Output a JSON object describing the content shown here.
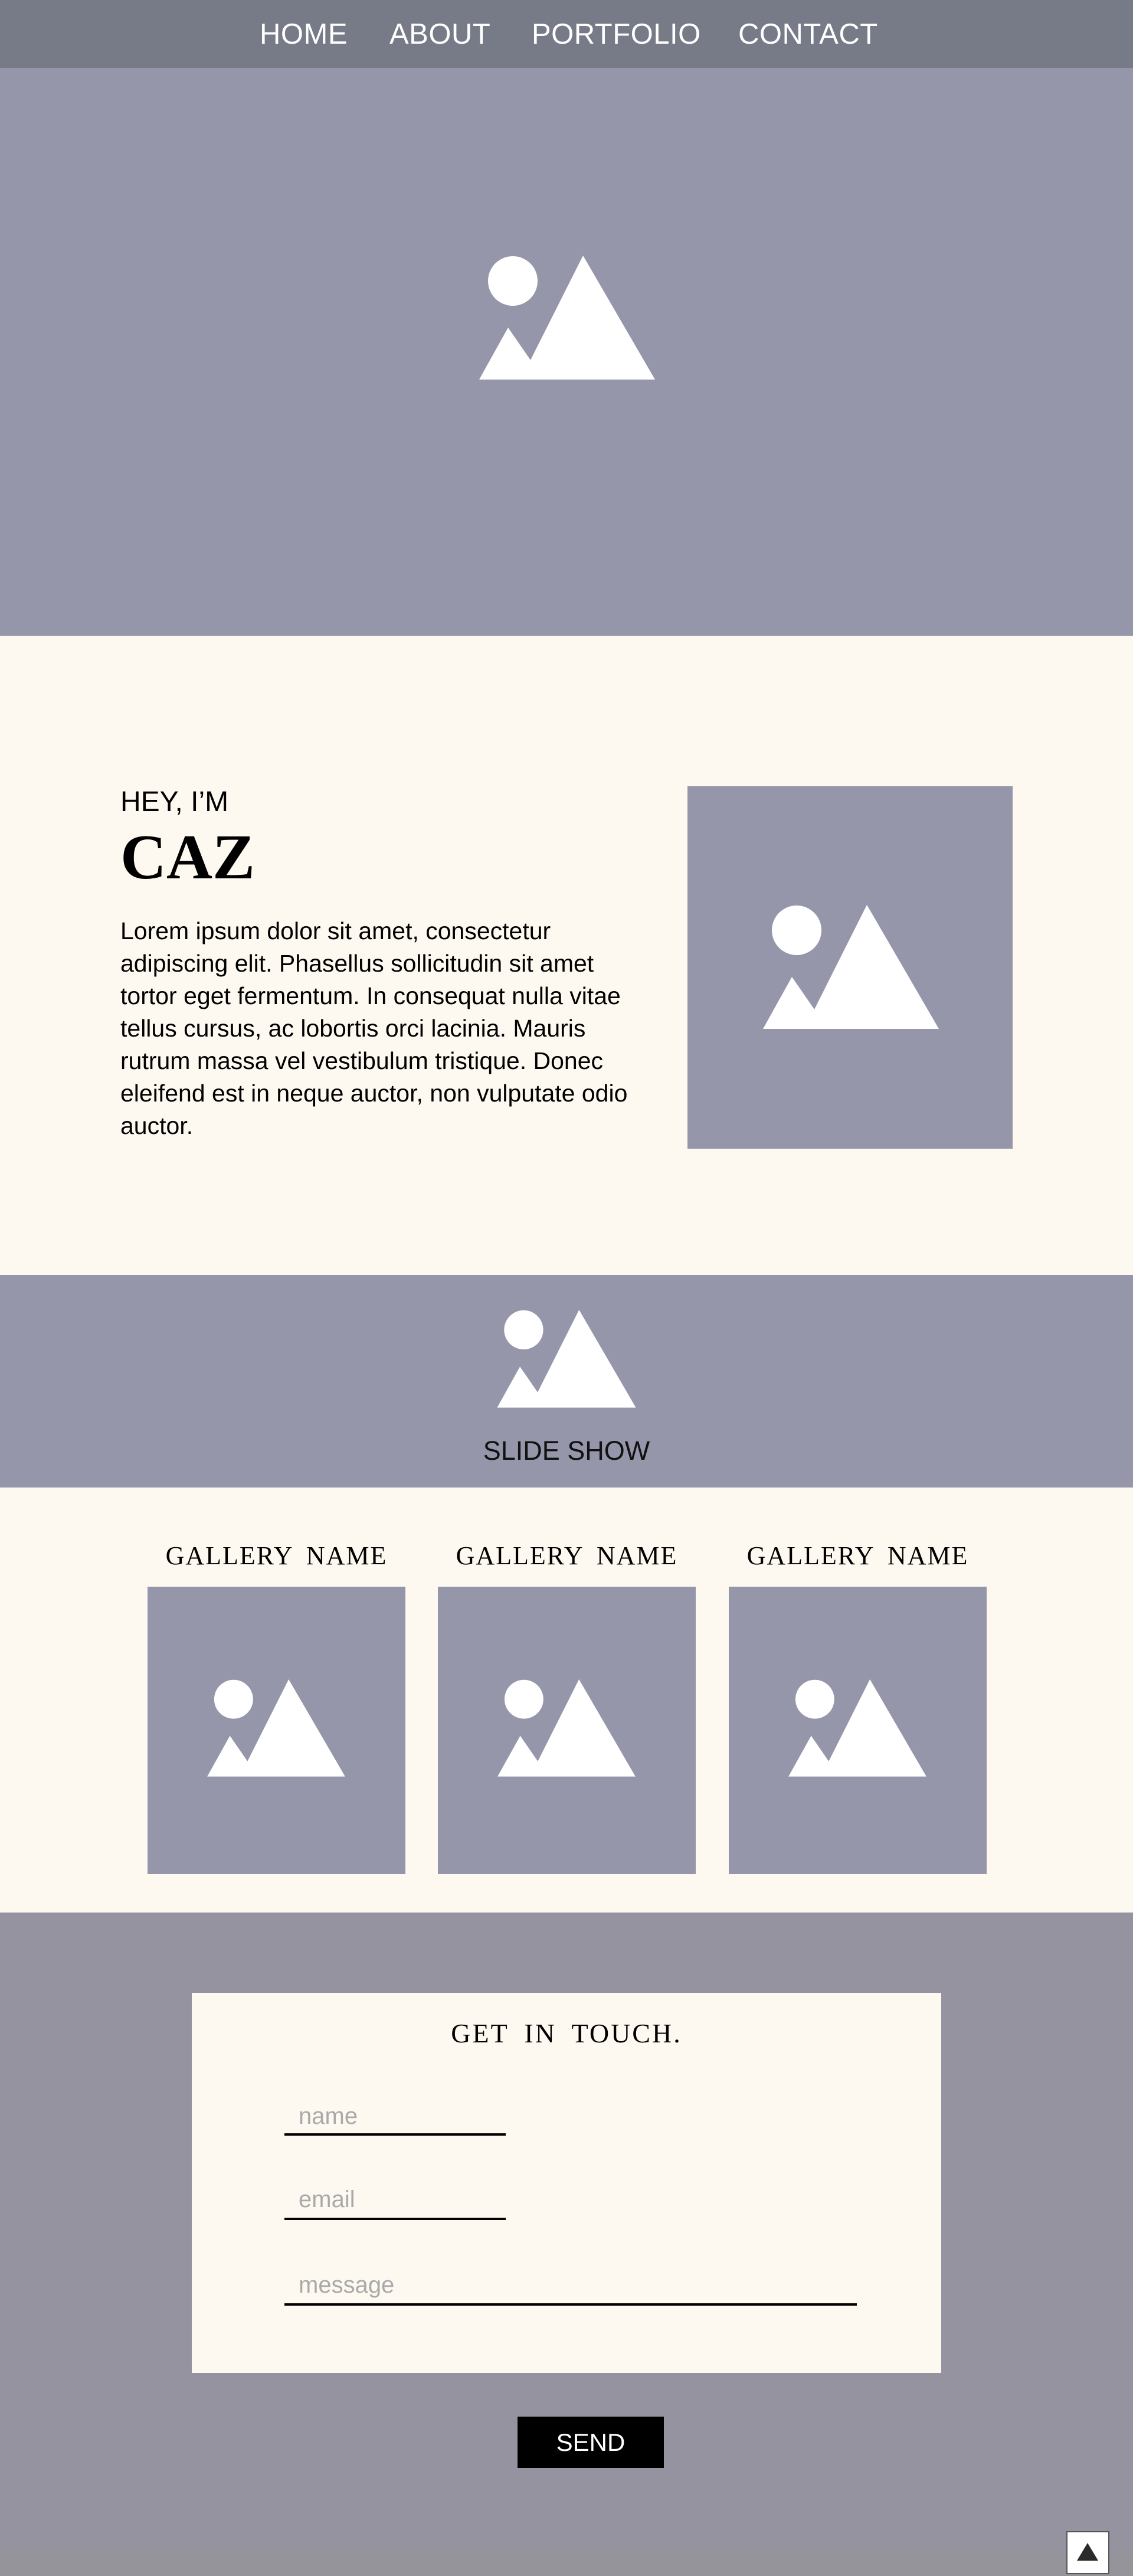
{
  "nav": {
    "items": [
      {
        "label": "HOME"
      },
      {
        "label": "ABOUT"
      },
      {
        "label": "PORTFOLIO"
      },
      {
        "label": "CONTACT"
      }
    ]
  },
  "hero": {
    "icon": "image-placeholder-icon"
  },
  "about": {
    "eyebrow": "HEY, I’M",
    "name": "CAZ",
    "body": "Lorem ipsum dolor sit amet, consectetur adipiscing elit. Phasellus sollicitudin sit amet tortor eget fermentum. In consequat nulla vitae tellus cursus, ac lobortis orci lacinia. Mauris rutrum massa vel vestibulum tristique. Donec eleifend est in neque auctor, non vulputate odio auctor.",
    "photo_icon": "image-placeholder-icon"
  },
  "slideshow": {
    "label": "SLIDE SHOW",
    "icon": "image-placeholder-icon"
  },
  "galleries": [
    {
      "name": "GALLERY NAME"
    },
    {
      "name": "GALLERY NAME"
    },
    {
      "name": "GALLERY NAME"
    }
  ],
  "contact": {
    "title": "GET IN TOUCH.",
    "name_placeholder": "name",
    "email_placeholder": "email",
    "message_placeholder": "message",
    "send_label": "SEND",
    "back_to_top_icon": "triangle-up-icon"
  },
  "colors": {
    "nav_bg": "#777a87",
    "placeholder_bg": "#9596aa",
    "cream": "#fef9f0",
    "contact_bg": "#95939f"
  }
}
